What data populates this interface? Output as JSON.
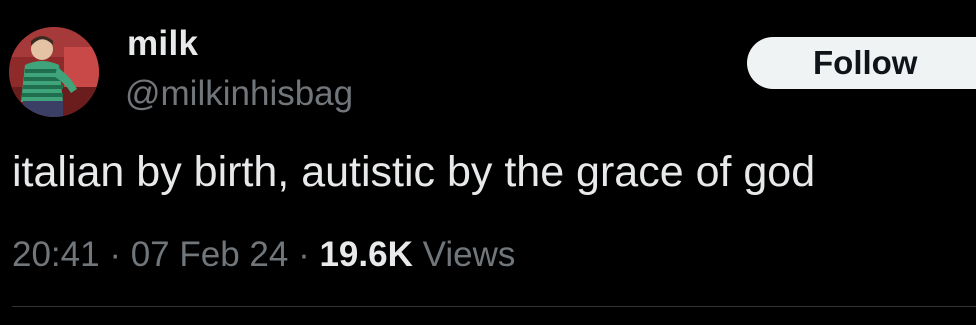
{
  "author": {
    "display_name": "milk",
    "handle": "@milkinhisbag",
    "avatar_icon": "profile-photo"
  },
  "follow_button": {
    "label": "Follow"
  },
  "tweet": {
    "text": "italian by birth, autistic by the grace of god"
  },
  "meta": {
    "time": "20:41",
    "separator": "·",
    "date": "07 Feb 24",
    "views_count": "19.6K",
    "views_label": "Views"
  },
  "colors": {
    "background": "#000000",
    "primary_text": "#e7e9ea",
    "secondary_text": "#71767b",
    "button_bg": "#eff3f4",
    "button_text": "#0f1419",
    "divider": "#2f3336"
  }
}
